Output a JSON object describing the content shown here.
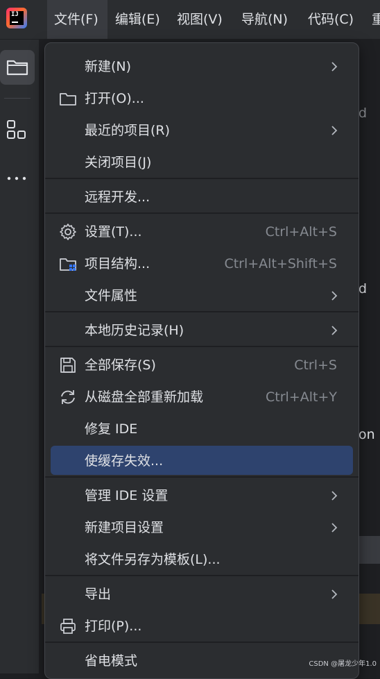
{
  "menubar": {
    "items": [
      "文件(F)",
      "编辑(E)",
      "视图(V)",
      "导航(N)",
      "代码(C)",
      "重"
    ],
    "active_index": 0
  },
  "background_fragments": [
    "d",
    "d",
    "on"
  ],
  "file_menu": {
    "groups": [
      [
        {
          "label": "新建(N)",
          "submenu": true,
          "icon": ""
        },
        {
          "label": "打开(O)...",
          "submenu": false,
          "icon": "folder-icon"
        },
        {
          "label": "最近的项目(R)",
          "submenu": true,
          "icon": ""
        },
        {
          "label": "关闭项目(J)",
          "submenu": false,
          "icon": ""
        }
      ],
      [
        {
          "label": "远程开发...",
          "submenu": false,
          "icon": ""
        }
      ],
      [
        {
          "label": "设置(T)...",
          "shortcut": "Ctrl+Alt+S",
          "icon": "gear-icon"
        },
        {
          "label": "项目结构...",
          "shortcut": "Ctrl+Alt+Shift+S",
          "icon": "project-structure-icon"
        },
        {
          "label": "文件属性",
          "submenu": true,
          "icon": ""
        }
      ],
      [
        {
          "label": "本地历史记录(H)",
          "submenu": true,
          "icon": ""
        }
      ],
      [
        {
          "label": "全部保存(S)",
          "shortcut": "Ctrl+S",
          "icon": "save-icon"
        },
        {
          "label": "从磁盘全部重新加载",
          "shortcut": "Ctrl+Alt+Y",
          "icon": "reload-icon"
        },
        {
          "label": "修复 IDE",
          "icon": ""
        },
        {
          "label": "使缓存失效...",
          "highlighted": true,
          "icon": ""
        }
      ],
      [
        {
          "label": "管理 IDE 设置",
          "submenu": true,
          "icon": ""
        },
        {
          "label": "新建项目设置",
          "submenu": true,
          "icon": ""
        },
        {
          "label": "将文件另存为模板(L)...",
          "icon": ""
        }
      ],
      [
        {
          "label": "导出",
          "submenu": true,
          "icon": ""
        },
        {
          "label": "打印(P)...",
          "icon": "print-icon"
        }
      ],
      [
        {
          "label": "省电模式",
          "icon": ""
        }
      ]
    ]
  },
  "watermark": "CSDN @屠龙少年1.0",
  "colors": {
    "highlight": "#2e436e",
    "menu_bg": "#2b2d30",
    "accent_icon": "#3574f0"
  }
}
